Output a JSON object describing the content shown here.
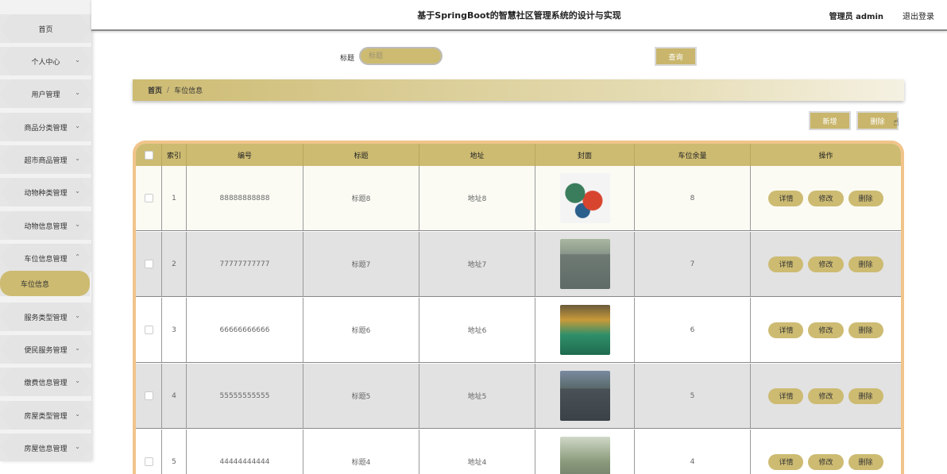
{
  "header": {
    "title": "基于SpringBoot的智慧社区管理系统的设计与实现",
    "user": "管理员 admin",
    "logout": "退出登录"
  },
  "sidebar": {
    "items": [
      {
        "label": "首页",
        "expandable": false
      },
      {
        "label": "个人中心",
        "expandable": true
      },
      {
        "label": "用户管理",
        "expandable": true
      },
      {
        "label": "商品分类管理",
        "expandable": true
      },
      {
        "label": "超市商品管理",
        "expandable": true
      },
      {
        "label": "动物种类管理",
        "expandable": true
      },
      {
        "label": "动物信息管理",
        "expandable": true
      },
      {
        "label": "车位信息管理",
        "expandable": true,
        "expanded": true
      },
      {
        "label": "车位信息",
        "active": true
      },
      {
        "label": "服务类型管理",
        "expandable": true
      },
      {
        "label": "便民服务管理",
        "expandable": true
      },
      {
        "label": "缴费信息管理",
        "expandable": true
      },
      {
        "label": "房屋类型管理",
        "expandable": true
      },
      {
        "label": "房屋信息管理",
        "expandable": true
      }
    ]
  },
  "search": {
    "label": "标题",
    "placeholder": "标题",
    "button": "查询"
  },
  "breadcrumb": {
    "home": "首页",
    "separator": "/",
    "current": "车位信息"
  },
  "actions": {
    "add": "新增",
    "delete": "删除"
  },
  "table": {
    "columns": [
      "索引",
      "编号",
      "标题",
      "地址",
      "封面",
      "车位余量",
      "操作"
    ],
    "rows": [
      {
        "index": "1",
        "code": "88888888888",
        "title": "标题8",
        "address": "地址8",
        "remaining": "8",
        "cover": "cartoon-illustration"
      },
      {
        "index": "2",
        "code": "77777777777",
        "title": "标题7",
        "address": "地址7",
        "remaining": "7",
        "cover": "parking-lot-photo"
      },
      {
        "index": "3",
        "code": "66666666666",
        "title": "标题6",
        "address": "地址6",
        "remaining": "6",
        "cover": "garage-photo"
      },
      {
        "index": "4",
        "code": "55555555555",
        "title": "标题5",
        "address": "地址5",
        "remaining": "5",
        "cover": "street-parking-photo"
      },
      {
        "index": "5",
        "code": "44444444444",
        "title": "标题4",
        "address": "地址4",
        "remaining": "4",
        "cover": "building-parking-photo"
      }
    ],
    "row_buttons": {
      "detail": "详情",
      "edit": "修改",
      "delete": "删除"
    }
  },
  "colors": {
    "accent": "#cdbb72",
    "table_border": "#f0c48a",
    "row_alt": "#e2e2e2"
  }
}
